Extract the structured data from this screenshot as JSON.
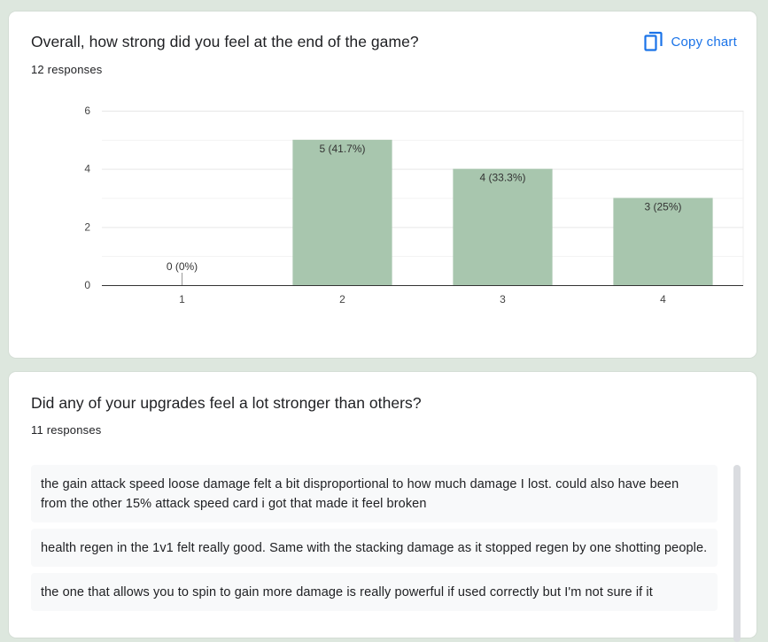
{
  "question1": {
    "title": "Overall, how strong did you feel at the end of the game?",
    "responses_count": "12 responses",
    "copy_label": "Copy chart",
    "copy_icon": "copy-icon",
    "accent_color": "#1a73e8"
  },
  "chart_data": {
    "type": "bar",
    "categories": [
      "1",
      "2",
      "3",
      "4"
    ],
    "values": [
      0,
      5,
      4,
      3
    ],
    "data_labels": [
      "0 (0%)",
      "5 (41.7%)",
      "4 (33.3%)",
      "3 (25%)"
    ],
    "y_ticks": [
      "0",
      "2",
      "4",
      "6"
    ],
    "ylim": [
      0,
      6
    ],
    "grid": true,
    "bar_color": "#a8c6ae",
    "title": "",
    "xlabel": "",
    "ylabel": ""
  },
  "question2": {
    "title": "Did any of your upgrades feel a lot stronger than others?",
    "responses_count": "11 responses",
    "answers": [
      "the gain attack speed loose damage felt a bit disproportional to how much damage I lost. could also have been from the other 15% attack speed card i got that made it feel broken",
      "health regen in the 1v1 felt really good. Same with the stacking damage as it stopped regen by one shotting people.",
      "the one that allows you to spin to gain more damage is really powerful if used correctly but I'm not sure if it"
    ]
  }
}
